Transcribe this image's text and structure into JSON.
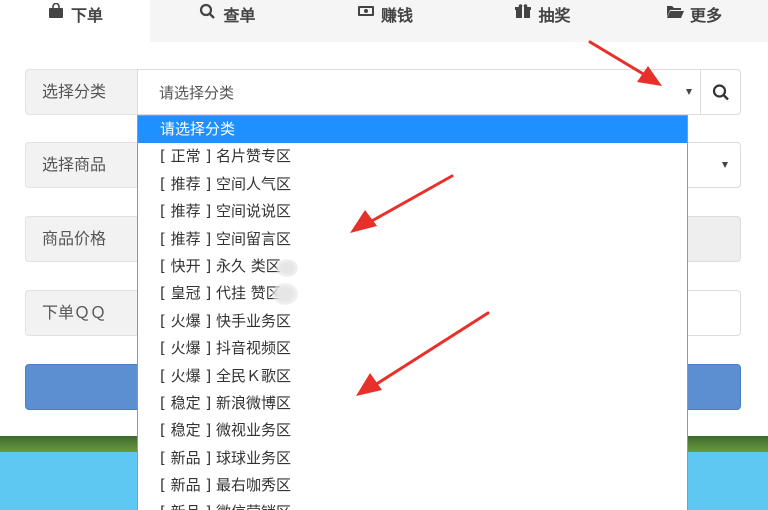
{
  "tabs": [
    {
      "label": "下单",
      "icon": "shopping-bag-icon",
      "active": true
    },
    {
      "label": "查单",
      "icon": "search-icon",
      "active": false
    },
    {
      "label": "赚钱",
      "icon": "money-icon",
      "active": false
    },
    {
      "label": "抽奖",
      "icon": "gift-icon",
      "active": false
    },
    {
      "label": "更多",
      "icon": "folder-open-icon",
      "active": false
    }
  ],
  "form": {
    "category_label": "选择分类",
    "category_value": "请选择分类",
    "product_label": "选择商品",
    "price_label": "商品价格",
    "qq_label": "下单ＱＱ"
  },
  "dropdown": {
    "options": [
      "请选择分类",
      "[ 正常 ] 名片赞专区",
      "[ 推荐 ] 空间人气区",
      "[ 推荐 ] 空间说说区",
      "[ 推荐 ] 空间留言区",
      "[ 快开 ] 永久  类区",
      "[ 皇冠 ] 代挂  赞区",
      "[ 火爆 ] 快手业务区",
      "[ 火爆 ] 抖音视频区",
      "[ 火爆 ] 全民Ｋ歌区",
      "[ 稳定 ] 新浪微博区",
      "[ 稳定 ] 微视业务区",
      "[ 新品 ] 球球业务区",
      "[ 新品 ] 最右咖秀区",
      "[ 新品 ] 微信营销区"
    ],
    "selected_index": 0
  },
  "colors": {
    "accent": "#5b8fd2",
    "selected_option": "#1e90ff",
    "arrow": "#e8302a"
  }
}
